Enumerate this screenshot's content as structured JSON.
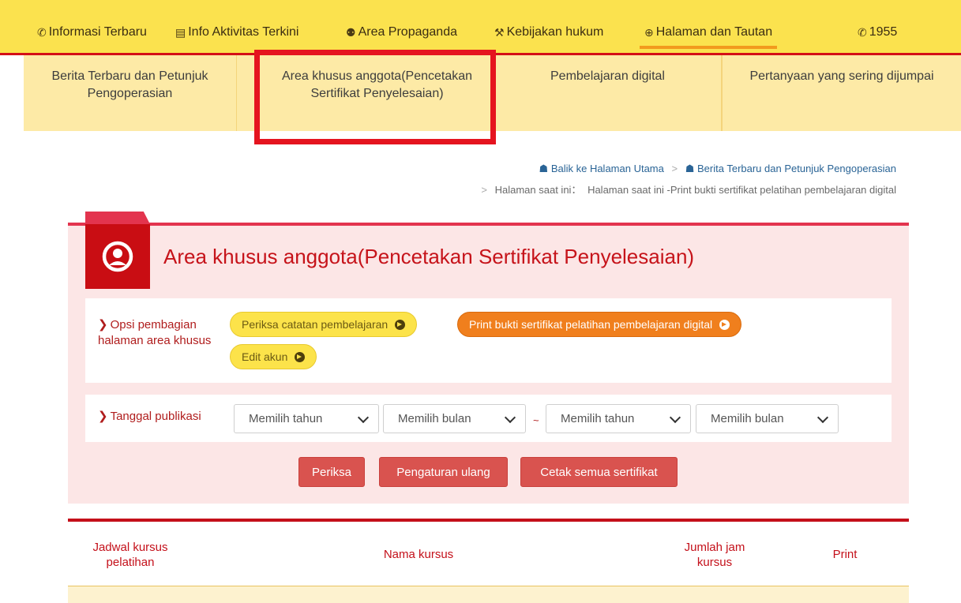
{
  "topnav": {
    "items": [
      {
        "icon": "megaphone-icon",
        "glyph": "✆",
        "label": "Informasi Terbaru"
      },
      {
        "icon": "newspaper-icon",
        "glyph": "▤",
        "label": "Info Aktivitas Terkini"
      },
      {
        "icon": "microphone-icon",
        "glyph": "⚉",
        "label": "Area Propaganda"
      },
      {
        "icon": "gavel-icon",
        "glyph": "⚒",
        "label": "Kebijakan hukum"
      },
      {
        "icon": "lifebuoy-icon",
        "glyph": "⊕",
        "label": "Halaman dan Tautan"
      },
      {
        "icon": "whatsapp-icon",
        "glyph": "✆",
        "label": "1955"
      }
    ],
    "active_index": 4
  },
  "subnav": {
    "tabs": [
      "Berita Terbaru dan Petunjuk Pengoperasian",
      "Area khusus anggota(Pencetakan Sertifikat Penyelesaian)",
      "Pembelajaran digital",
      "Pertanyaan yang sering dijumpai"
    ],
    "highlighted_index": 1
  },
  "breadcrumb": {
    "home": "Balik ke Halaman Utama",
    "section": "Berita Terbaru dan Petunjuk Pengoperasian",
    "current_prefix": "Halaman saat ini：",
    "current": "Halaman saat ini -Print bukti sertifikat pelatihan pembelajaran digital",
    "separator": ">"
  },
  "panel": {
    "title": "Area khusus anggota(Pencetakan Sertifikat Penyelesaian)",
    "opsi_label": "Opsi pembagian halaman area khusus",
    "options": [
      "Periksa catatan pembelajaran",
      "Print bukti sertifikat pelatihan pembelajaran digital",
      "Edit akun"
    ],
    "active_option": 1,
    "date_label": "Tanggal publikasi",
    "selects": [
      "Memilih tahun",
      "Memilih bulan",
      "Memilih tahun",
      "Memilih bulan"
    ],
    "range_sep": "~",
    "buttons": {
      "check": "Periksa",
      "reset": "Pengaturan ulang",
      "print_all": "Cetak semua sertifikat"
    }
  },
  "table": {
    "headers": [
      "Jadwal kursus pelatihan",
      "Nama kursus",
      "Jumlah jam kursus",
      "Print"
    ]
  },
  "colors": {
    "topbar": "#fbe24e",
    "accent_red": "#c4101a",
    "panel_bg": "#fce6e6",
    "active_pill": "#f07f1d",
    "pill": "#fce34a",
    "button": "#d9534f"
  }
}
